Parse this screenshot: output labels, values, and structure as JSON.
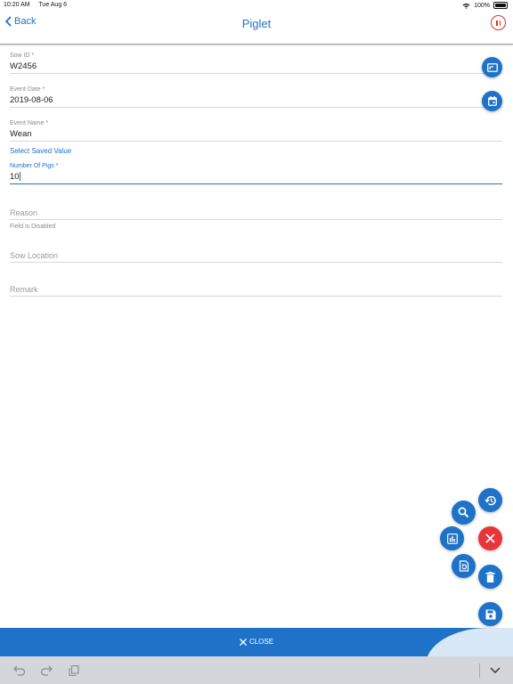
{
  "status_bar": {
    "time": "10:20 AM",
    "date": "Tue Aug 6",
    "battery": "100%"
  },
  "nav": {
    "back_label": "Back",
    "title": "Piglet"
  },
  "form": {
    "sow_id": {
      "label": "Sow ID *",
      "value": "W2456"
    },
    "event_date": {
      "label": "Event Date *",
      "value": "2019-08-06"
    },
    "event_name": {
      "label": "Event Name *",
      "value": "Wean"
    },
    "select_saved_value": "Select Saved Value",
    "number_of_pigs": {
      "label": "Number Of Pigs *",
      "value": "10"
    },
    "reason": {
      "placeholder": "Reason",
      "hint": "Field is Disabled"
    },
    "sow_location": {
      "placeholder": "Sow Location"
    },
    "remark": {
      "placeholder": "Remark"
    }
  },
  "fab_icons": [
    "history-icon",
    "search-icon",
    "close-icon",
    "bar-chart-icon",
    "reset-icon",
    "delete-icon",
    "save-icon"
  ],
  "close_bar": {
    "label": "CLOSE"
  },
  "colors": {
    "primary": "#1e73c8",
    "danger": "#e8353a",
    "keyboard_bar": "#d4d6db"
  }
}
